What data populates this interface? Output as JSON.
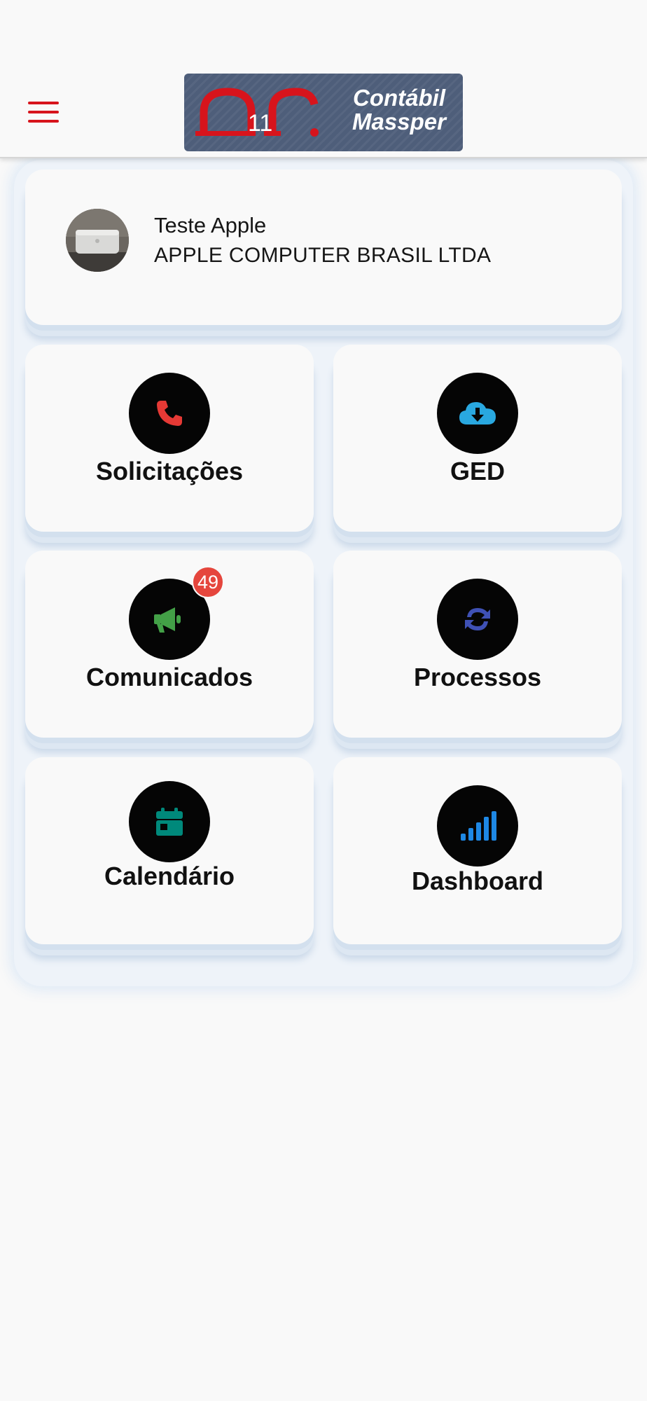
{
  "header": {
    "menu_icon": "hamburger-menu-icon",
    "logo": {
      "text_line1": "Contábil",
      "text_line2": "Massper",
      "mark_digits": "11"
    }
  },
  "profile": {
    "name": "Teste Apple",
    "company": "APPLE COMPUTER BRASIL LTDA"
  },
  "tiles": [
    {
      "label": "Solicitações",
      "icon": "phone-icon",
      "icon_color": "#e53935"
    },
    {
      "label": "GED",
      "icon": "cloud-download-icon",
      "icon_color": "#29a8e0"
    },
    {
      "label": "Comunicados",
      "icon": "megaphone-icon",
      "icon_color": "#43a047",
      "badge": "49"
    },
    {
      "label": "Processos",
      "icon": "sync-icon",
      "icon_color": "#3f51b5"
    },
    {
      "label": "Calendário",
      "icon": "calendar-icon",
      "icon_color": "#00897b"
    },
    {
      "label": "Dashboard",
      "icon": "signal-bars-icon",
      "icon_color": "#1e88e5"
    }
  ],
  "colors": {
    "brand_red": "#d7141c",
    "logo_bg": "#4e5e7a",
    "badge": "#e5463d"
  }
}
